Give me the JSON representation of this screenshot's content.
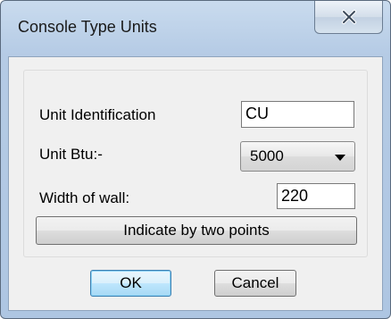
{
  "window": {
    "title": "Console Type Units"
  },
  "form": {
    "unit_identification_label": "Unit Identification",
    "unit_identification_value": "CU",
    "unit_btu_label": "Unit Btu:-",
    "unit_btu_value": "5000",
    "width_of_wall_label": "Width  of  wall:",
    "width_of_wall_value": "220",
    "indicate_button_label": "Indicate by two points"
  },
  "buttons": {
    "ok_label": "OK",
    "cancel_label": "Cancel"
  }
}
